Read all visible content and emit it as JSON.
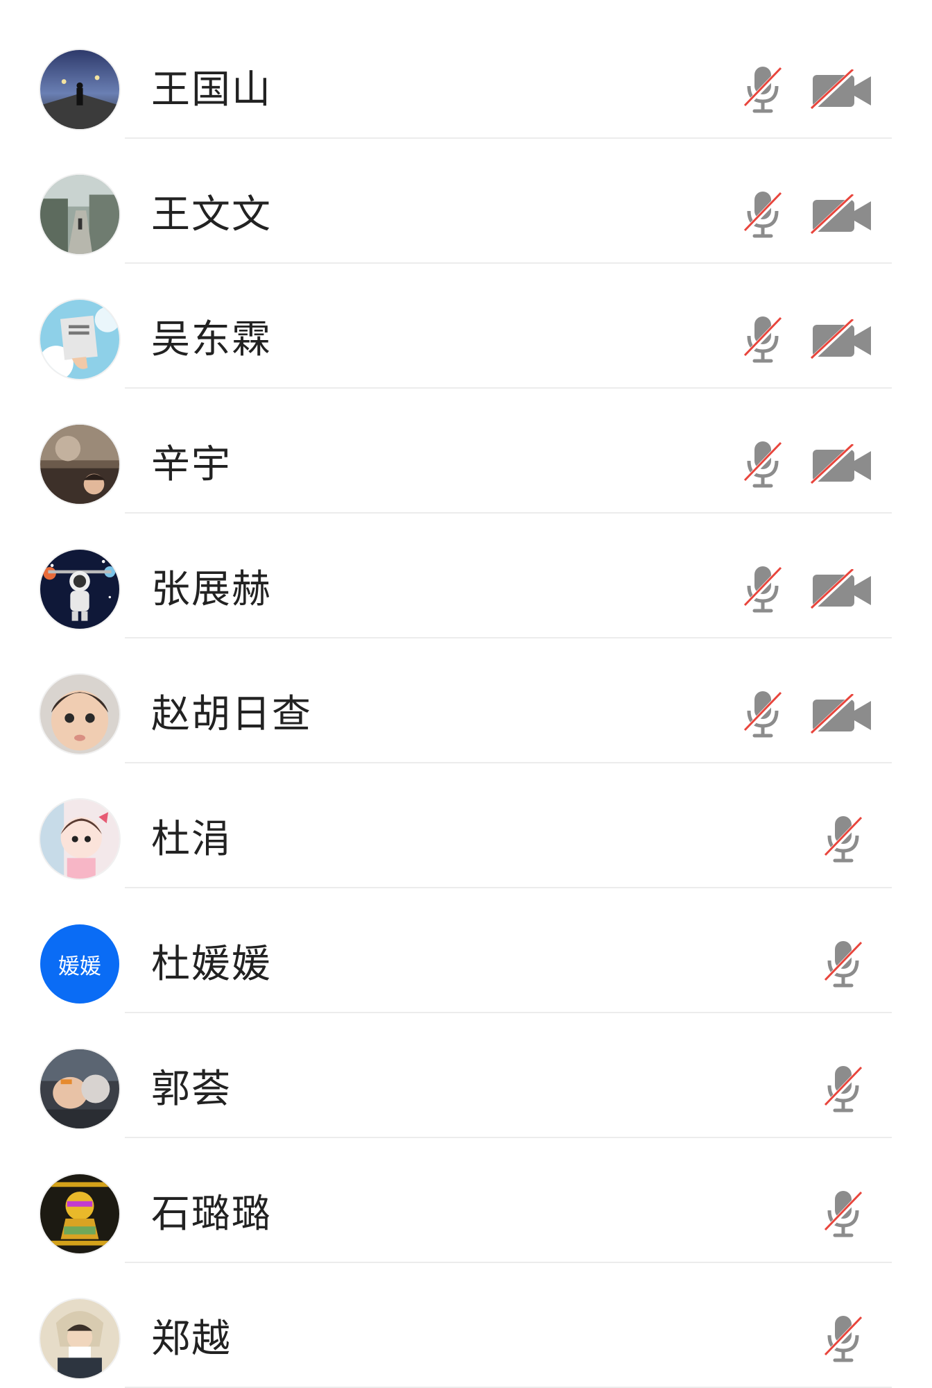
{
  "participants": [
    {
      "name": "王国山",
      "mic_muted": true,
      "camera": "off"
    },
    {
      "name": "王文文",
      "mic_muted": true,
      "camera": "off"
    },
    {
      "name": "吴东霖",
      "mic_muted": true,
      "camera": "off"
    },
    {
      "name": "辛宇",
      "mic_muted": true,
      "camera": "off"
    },
    {
      "name": "张展赫",
      "mic_muted": true,
      "camera": "off"
    },
    {
      "name": "赵胡日查",
      "mic_muted": true,
      "camera": "off"
    },
    {
      "name": "杜涓",
      "mic_muted": true
    },
    {
      "name": "杜媛媛",
      "mic_muted": true,
      "avatar_text": "媛媛"
    },
    {
      "name": "郭荟",
      "mic_muted": true
    },
    {
      "name": "石璐璐",
      "mic_muted": true
    },
    {
      "name": "郑越",
      "mic_muted": true
    }
  ],
  "icons": {
    "mic": "mic-muted-icon",
    "camera": "camera-off-icon"
  },
  "colors": {
    "icon_gray": "#8c8c8c",
    "strike_red": "#e8453c",
    "avatar_blue": "#0a6cf5",
    "name_text": "#222222",
    "divider": "#ececec"
  }
}
